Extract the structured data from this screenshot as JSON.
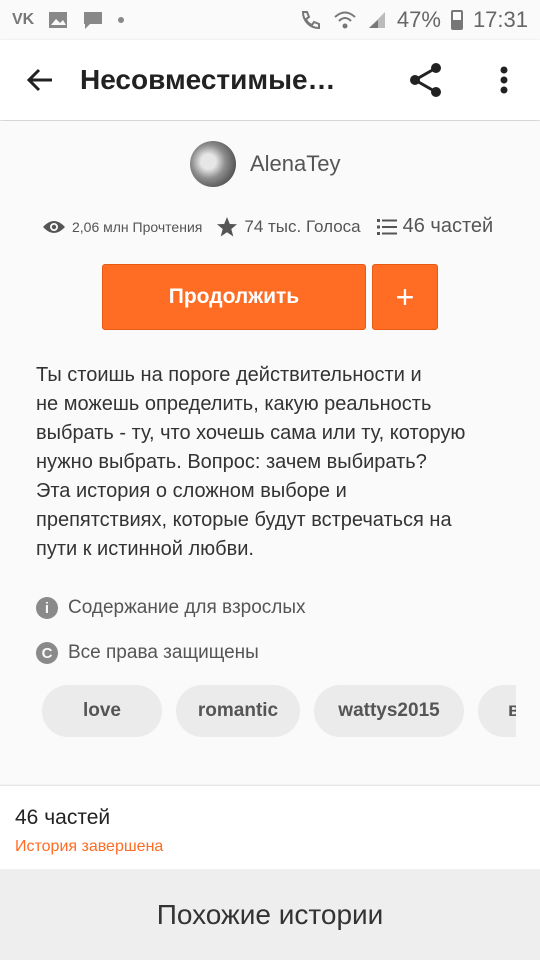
{
  "status_bar": {
    "left_icons": [
      "vk-icon",
      "image-icon",
      "chat-icon",
      "dot"
    ],
    "battery": "47%",
    "time": "17:31",
    "battery_level": 0.47
  },
  "app_bar": {
    "title": "Несовместимые…"
  },
  "story": {
    "author": "AlenaTey",
    "reads": "2,06 млн Прочтения",
    "votes": "74 тыс. Голоса",
    "parts": "46 частей",
    "continue_label": "Продолжить",
    "add_label": "+",
    "description": "Ты стоишь на пороге действительности и\nне можешь определить, какую реальность\nвыбрать - ту, что хочешь сама или ту, которую\nнужно выбрать. Вопрос: зачем выбирать?\nЭта история о сложном выборе и\nпрепятствиях, которые будут встречаться на\nпути к истинной любви.",
    "mature_label": "Содержание для взрослых",
    "copyright_label": "Все права защищены",
    "tags": [
      "love",
      "romantic",
      "wattys2015",
      "вы"
    ]
  },
  "parts_section": {
    "count": "46 частей",
    "status": "История завершена"
  },
  "similar": {
    "title": "Похожие истории"
  },
  "colors": {
    "accent": "#ff6c23",
    "background": "#fafafa",
    "tag_bg": "#ebebeb"
  }
}
